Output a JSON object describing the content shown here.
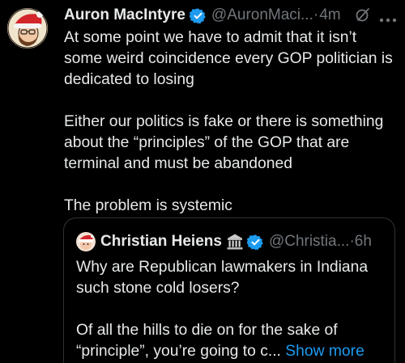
{
  "colors": {
    "background": "#000000",
    "text_primary": "#e7e9ea",
    "text_secondary": "#71767b",
    "link": "#1d9bf0",
    "verified_badge": "#1d9bf0",
    "border": "#2f3336"
  },
  "tweet": {
    "author_name": "Auron MacIntyre",
    "author_handle": "@AuronMaci...",
    "separator": "·",
    "time": "4m",
    "icons": [
      "verified-badge-icon",
      "grok-icon",
      "more-icon"
    ],
    "lines": [
      "At some point we have to admit that it isn’t",
      "some weird coincidence every GOP politician is",
      "dedicated to losing",
      "",
      "Either our politics is fake or there is something",
      "about the “principles” of the GOP that are",
      "terminal and must be abandoned",
      "",
      "The problem is systemic"
    ]
  },
  "quote": {
    "author_name": "Christian Heiens",
    "author_emoji_icon": "classical-building-icon",
    "author_handle": "@Christia...",
    "separator": "·",
    "time": "6h",
    "lines": [
      "Why are Republican lawmakers in Indiana",
      "such stone cold losers?",
      "",
      "Of all the hills to die on for the sake of"
    ],
    "last_line_prefix": "“principle”, you’re going to c...",
    "show_more_label": "Show more"
  }
}
